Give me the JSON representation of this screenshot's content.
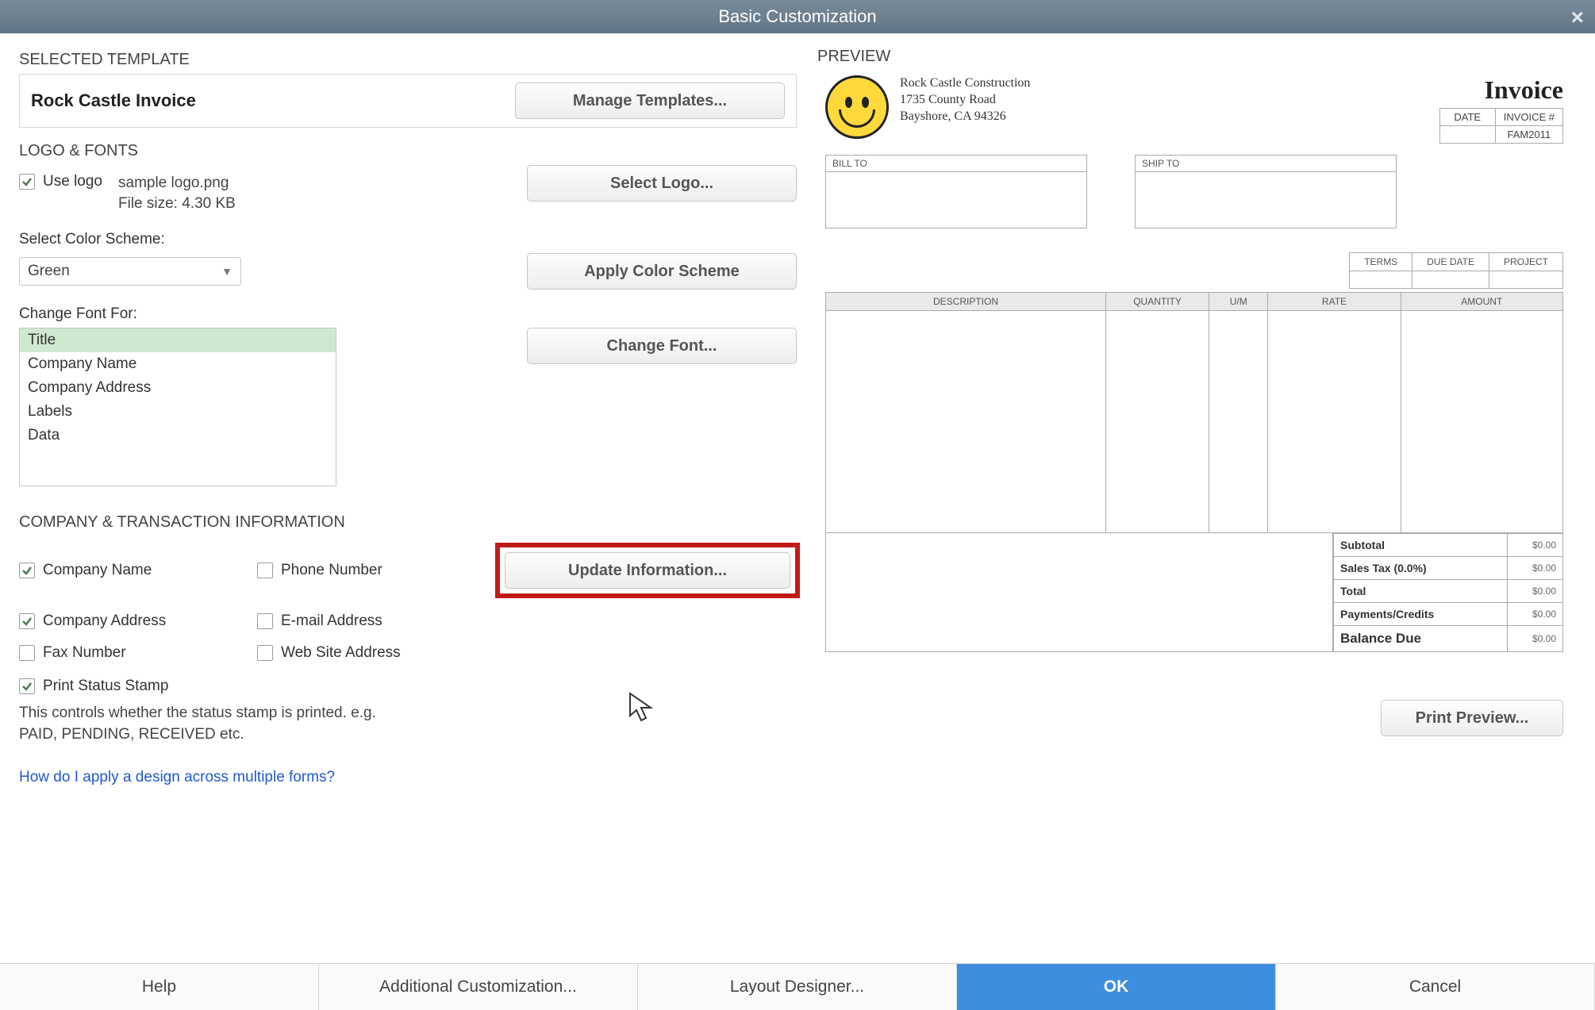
{
  "titlebar": {
    "title": "Basic Customization"
  },
  "sections": {
    "selected_template": "SELECTED TEMPLATE",
    "logo_fonts": "LOGO & FONTS",
    "company_info": "COMPANY & TRANSACTION INFORMATION",
    "preview": "PREVIEW"
  },
  "template": {
    "name": "Rock Castle Invoice",
    "manage_btn": "Manage Templates..."
  },
  "logo": {
    "use_logo_label": "Use logo",
    "filename": "sample logo.png",
    "filesize": "File size: 4.30 KB",
    "select_btn": "Select Logo..."
  },
  "color_scheme": {
    "label": "Select Color Scheme:",
    "value": "Green",
    "apply_btn": "Apply Color Scheme"
  },
  "fonts": {
    "label": "Change Font For:",
    "items": [
      "Title",
      "Company Name",
      "Company Address",
      "Labels",
      "Data"
    ],
    "change_btn": "Change Font..."
  },
  "company": {
    "name": "Company Name",
    "address": "Company Address",
    "fax": "Fax Number",
    "phone": "Phone Number",
    "email": "E-mail Address",
    "website": "Web Site Address",
    "update_btn": "Update Information...",
    "print_stamp": "Print Status Stamp",
    "stamp_desc1": "This controls whether the status stamp is printed. e.g.",
    "stamp_desc2": "PAID, PENDING, RECEIVED etc."
  },
  "link_text": "How do I apply a design across multiple forms?",
  "preview": {
    "company_name": "Rock Castle Construction",
    "addr1": "1735 County Road",
    "addr2": "Bayshore, CA 94326",
    "doc_title": "Invoice",
    "header_cols": {
      "date": "DATE",
      "invno": "INVOICE #"
    },
    "header_vals": {
      "date": "",
      "invno": "FAM2011"
    },
    "bill_to": "BILL TO",
    "ship_to": "SHIP TO",
    "terms_cols": {
      "terms": "TERMS",
      "due": "DUE DATE",
      "project": "PROJECT"
    },
    "item_cols": {
      "desc": "DESCRIPTION",
      "qty": "QUANTITY",
      "um": "U/M",
      "rate": "RATE",
      "amount": "AMOUNT"
    },
    "totals": {
      "subtotal": "Subtotal",
      "tax": "Sales Tax  (0.0%)",
      "total": "Total",
      "payments": "Payments/Credits",
      "balance": "Balance Due",
      "zero": "$0.00"
    },
    "print_preview_btn": "Print Preview..."
  },
  "bottom": {
    "help": "Help",
    "additional": "Additional Customization...",
    "layout": "Layout Designer...",
    "ok": "OK",
    "cancel": "Cancel"
  }
}
